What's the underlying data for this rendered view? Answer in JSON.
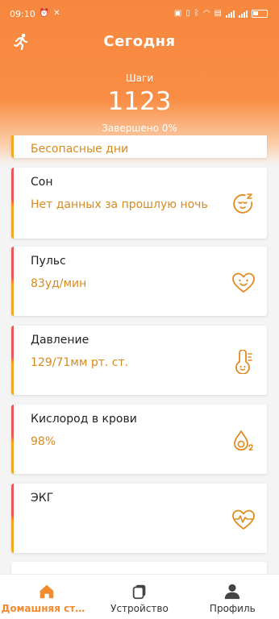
{
  "status_bar": {
    "time": "09:10",
    "battery_percent": 31
  },
  "header": {
    "title": "Сегодня",
    "steps_label": "Шаги",
    "steps_value": "1123",
    "steps_complete": "Завершено 0%",
    "left_icon": "runner-icon"
  },
  "safe_days": {
    "label": "Бесопасные дни"
  },
  "cards": [
    {
      "name": "Сон",
      "value": "Нет данных за прошлую ночь",
      "icon": "sleep-face-icon"
    },
    {
      "name": "Пульс",
      "value": "83уд/мин",
      "icon": "heart-face-icon"
    },
    {
      "name": "Давление",
      "value": "129/71мм рт. ст.",
      "icon": "thermometer-face-icon"
    },
    {
      "name": "Кислород в крови",
      "value": "98%",
      "icon": "oxygen-drop-icon"
    },
    {
      "name": "ЭКГ",
      "value": "",
      "icon": "ecg-heart-icon"
    }
  ],
  "bottom_nav": [
    {
      "label": "Домашняя стр...",
      "icon": "home-icon",
      "active": true
    },
    {
      "label": "Устройство",
      "icon": "device-icon",
      "active": false
    },
    {
      "label": "Профиль",
      "icon": "profile-icon",
      "active": false
    }
  ],
  "colors": {
    "accent_orange": "#f7873f",
    "value_orange": "#d98a1e",
    "icon_orange": "#e38a1f",
    "card_stripe_top": "#e85a5a",
    "card_stripe_bottom": "#f5a623"
  }
}
